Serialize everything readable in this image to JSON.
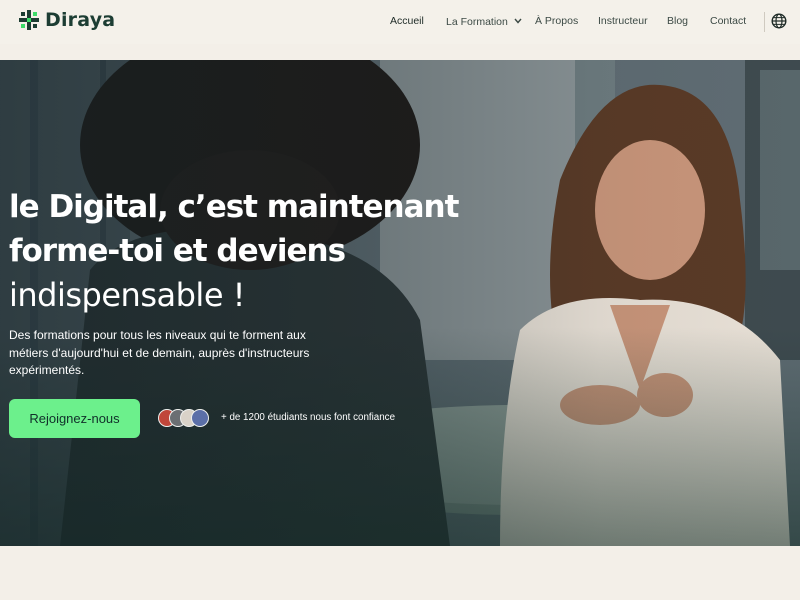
{
  "brand": {
    "name": "Diraya",
    "logo_icon": "diraya-logo-icon",
    "color": "#1c3d33"
  },
  "nav": {
    "items": [
      {
        "label": "Accueil",
        "active": true
      },
      {
        "label": "La Formation",
        "has_dropdown": true
      },
      {
        "label": "À Propos"
      },
      {
        "label": "Instructeur"
      },
      {
        "label": "Blog"
      },
      {
        "label": "Contact"
      }
    ],
    "language_icon": "globe-icon"
  },
  "hero": {
    "headline_line1": "le Digital, c’est maintenant",
    "headline_line2": "forme-toi et deviens",
    "headline_line3": "indispensable !",
    "description": "Des formations pour tous les niveaux qui te forment aux métiers d'aujourd'hui et de demain, auprès d'instructeurs expérimentés.",
    "cta_label": "Rejoignez-nous",
    "trust_text": "+ de 1200 étudiants nous font confiance",
    "cta_color": "#6cf08c"
  }
}
